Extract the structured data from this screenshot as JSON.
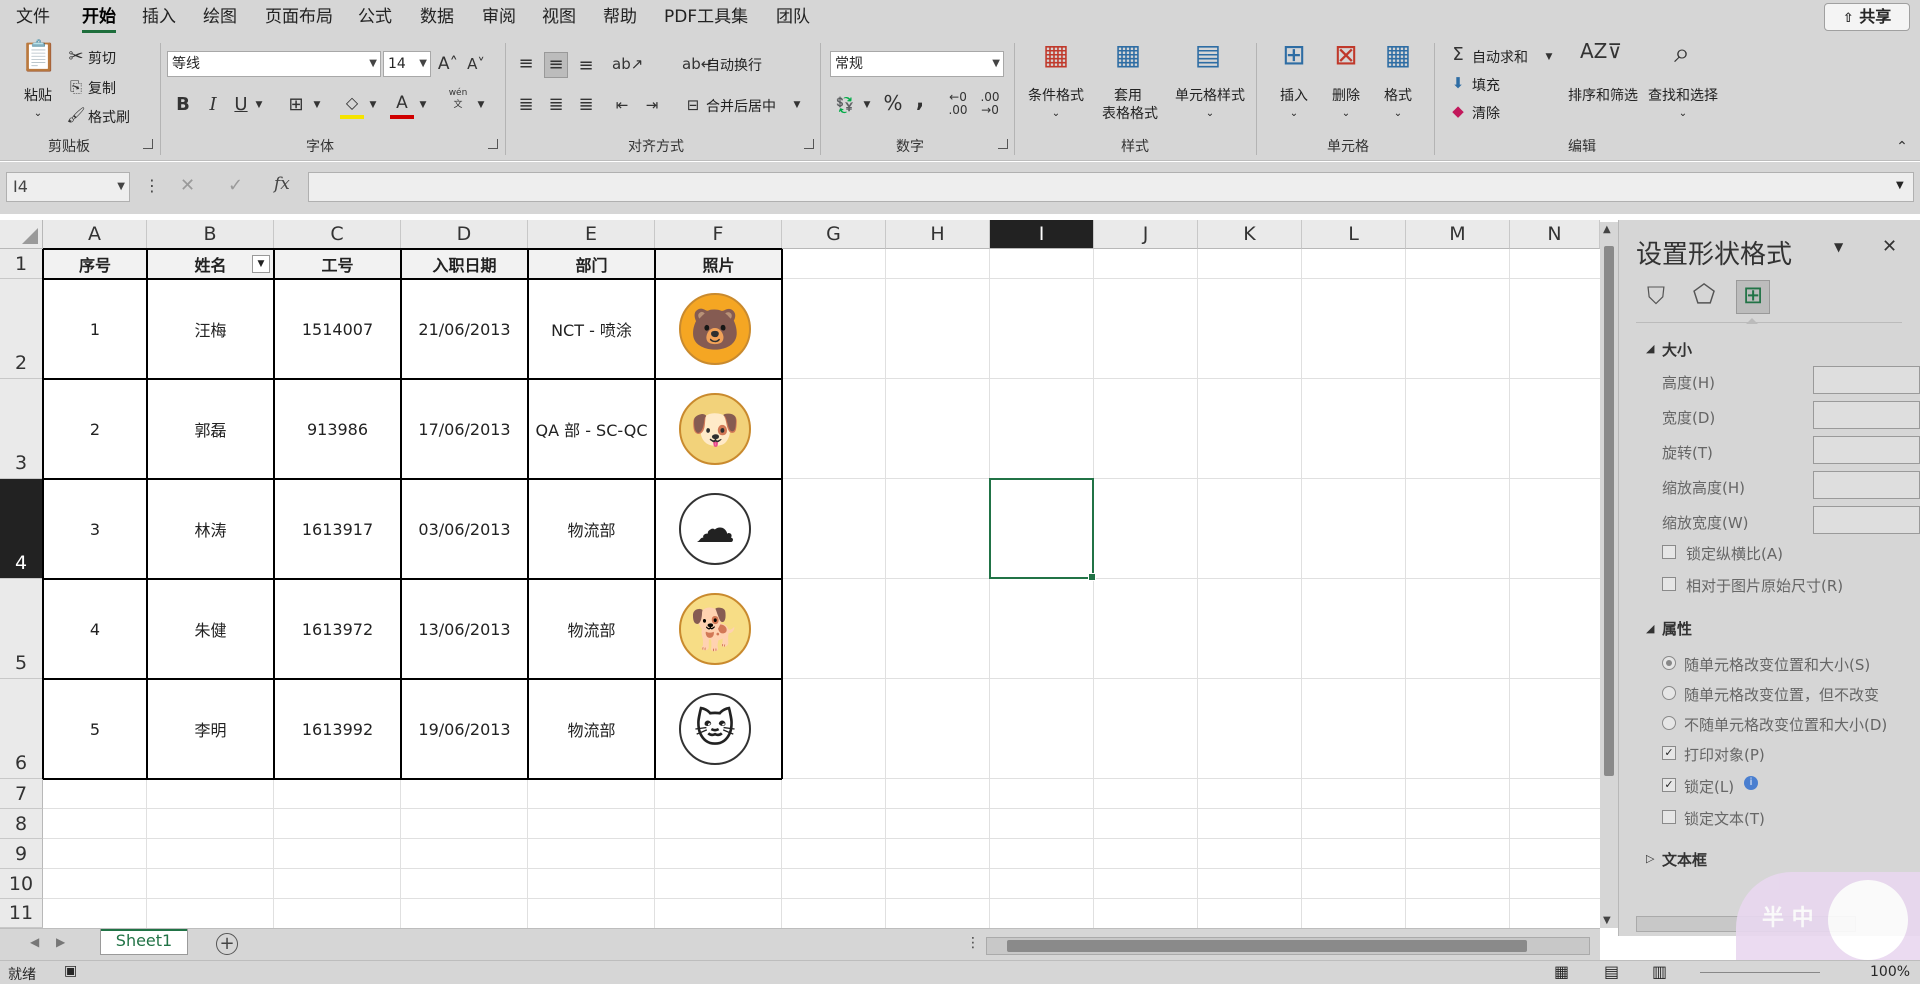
{
  "menu": {
    "tabs": [
      "文件",
      "开始",
      "插入",
      "绘图",
      "页面布局",
      "公式",
      "数据",
      "审阅",
      "视图",
      "帮助",
      "PDF工具集",
      "团队"
    ],
    "active": "开始",
    "share": "共享"
  },
  "ribbon": {
    "clipboard": {
      "label": "剪贴板",
      "paste": "粘贴",
      "cut": "剪切",
      "copy": "复制",
      "format_painter": "格式刷"
    },
    "font": {
      "label": "字体",
      "font_name": "等线",
      "font_size": "14",
      "bold": "B",
      "italic": "I",
      "underline": "U",
      "phonetic": "wén"
    },
    "alignment": {
      "label": "对齐方式",
      "wrap": "自动换行",
      "merge": "合并后居中"
    },
    "number": {
      "label": "数字",
      "format": "常规",
      "percent": "%",
      "comma": ","
    },
    "styles": {
      "label": "样式",
      "conditional": "条件格式",
      "table_line1": "套用",
      "table_line2": "表格格式",
      "cell_styles": "单元格样式"
    },
    "cells": {
      "label": "单元格",
      "insert": "插入",
      "delete": "删除",
      "format": "格式"
    },
    "editing": {
      "label": "编辑",
      "autosum": "自动求和",
      "fill": "填充",
      "clear": "清除",
      "sort": "排序和筛选",
      "find": "查找和选择"
    }
  },
  "formula_bar": {
    "name_box": "I4",
    "fx": "fx",
    "formula": ""
  },
  "columns": [
    "A",
    "B",
    "C",
    "D",
    "E",
    "F",
    "G",
    "H",
    "I",
    "J",
    "K",
    "L",
    "M",
    "N"
  ],
  "selected_column": "I",
  "rows": [
    "1",
    "2",
    "3",
    "4",
    "5",
    "6",
    "7",
    "8",
    "9",
    "10",
    "11"
  ],
  "selected_row": "4",
  "table": {
    "headers": [
      "序号",
      "姓名",
      "工号",
      "入职日期",
      "部门",
      "照片"
    ],
    "rows": [
      [
        "1",
        "汪梅",
        "1514007",
        "21/06/2013",
        "NCT - 喷涂"
      ],
      [
        "2",
        "郭磊",
        "913986",
        "17/06/2013",
        "QA 部 - SC-QC"
      ],
      [
        "3",
        "林涛",
        "1613917",
        "03/06/2013",
        "物流部"
      ],
      [
        "4",
        "朱健",
        "1613972",
        "13/06/2013",
        "物流部"
      ],
      [
        "5",
        "李明",
        "1613992",
        "19/06/2013",
        "物流部"
      ]
    ],
    "photos": [
      "bear-sticker",
      "dog-sticker",
      "cloud-sticker",
      "pompompurin-sticker",
      "hello-kitty-sticker"
    ]
  },
  "pane": {
    "title": "设置形状格式",
    "size_section": "大小",
    "height": "高度(H)",
    "width": "宽度(D)",
    "rotation": "旋转(T)",
    "scale_h": "缩放高度(H)",
    "scale_w": "缩放宽度(W)",
    "lock_ratio": "锁定纵横比(A)",
    "relative": "相对于图片原始尺寸(R)",
    "props_section": "属性",
    "move_size": "随单元格改变位置和大小(S)",
    "move_only": "随单元格改变位置，但不改变",
    "no_move": "不随单元格改变位置和大小(D)",
    "print_obj": "打印对象(P)",
    "locked": "锁定(L)",
    "lock_text": "锁定文本(T)",
    "textbox_section": "文本框"
  },
  "sheet_tab": "Sheet1",
  "status": {
    "ready": "就绪",
    "zoom": "100%"
  },
  "watermark": "半 中",
  "colors": {
    "accent": "#217346",
    "chrome": "#d6d6d6"
  }
}
